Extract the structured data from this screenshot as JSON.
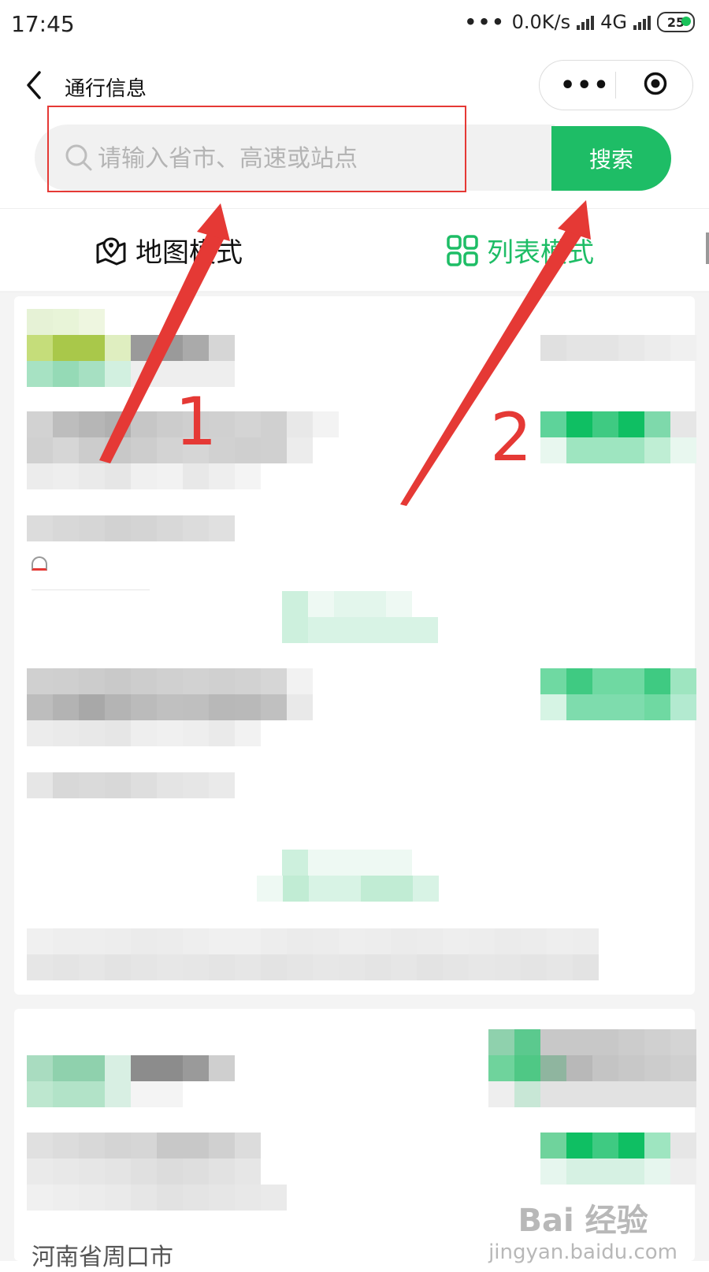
{
  "status_bar": {
    "time": "17:45",
    "network_speed": "0.0K/s",
    "network_type": "4G",
    "battery": "25"
  },
  "titlebar": {
    "title": "通行信息"
  },
  "search": {
    "placeholder": "请输入省市、高速或站点",
    "button_label": "搜索"
  },
  "tabs": [
    {
      "label": "地图模式",
      "icon": "map-pin-icon",
      "active": false
    },
    {
      "label": "列表模式",
      "icon": "grid-icon",
      "active": true
    }
  ],
  "annotations": {
    "label_1": "1",
    "label_2": "2"
  },
  "footer": {
    "partial_text": "河南省周口市"
  },
  "watermark": {
    "brand": "Bai 经验",
    "url": "jingyan.baidu.com"
  },
  "colors": {
    "accent_green": "#1ebd66",
    "annotation_red": "#e53935"
  }
}
